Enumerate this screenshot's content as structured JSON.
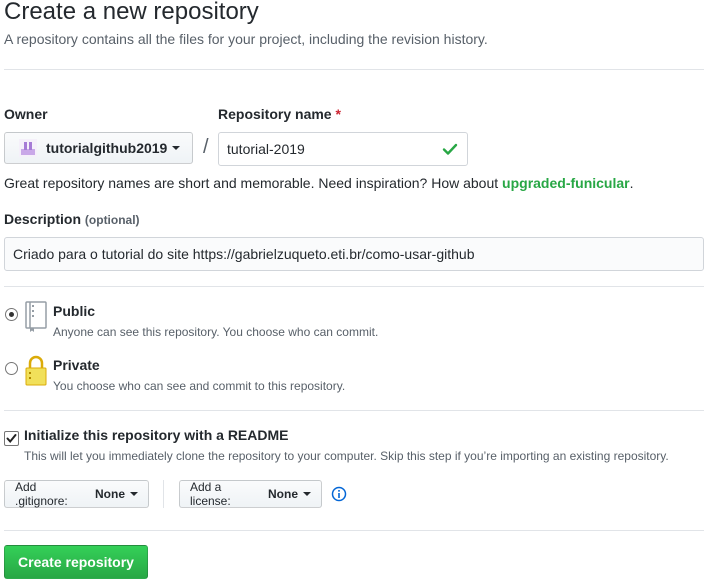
{
  "header": {
    "title": "Create a new repository",
    "subtitle": "A repository contains all the files for your project, including the revision history."
  },
  "owner": {
    "label": "Owner",
    "value": "tutorialgithub2019"
  },
  "separator": "/",
  "repo_name": {
    "label": "Repository name",
    "required_mark": "*",
    "value": "tutorial-2019"
  },
  "name_hint": {
    "prefix": "Great repository names are short and memorable. Need inspiration? How about ",
    "suggestion": "upgraded-funicular",
    "suffix": "."
  },
  "description": {
    "label": "Description",
    "optional": "(optional)",
    "value": "Criado para o tutorial do site https://gabrielzuqueto.eti.br/como-usar-github"
  },
  "visibility": {
    "selected": "public",
    "public": {
      "title": "Public",
      "note": "Anyone can see this repository. You choose who can commit.",
      "icon": "repo-book-icon"
    },
    "private": {
      "title": "Private",
      "note": "You choose who can see and commit to this repository.",
      "icon": "lock-icon"
    }
  },
  "readme": {
    "checked": true,
    "title": "Initialize this repository with a README",
    "note": "This will let you immediately clone the repository to your computer. Skip this step if you’re importing an existing repository."
  },
  "gitignore": {
    "label": "Add .gitignore:",
    "value": "None"
  },
  "license": {
    "label": "Add a license:",
    "value": "None"
  },
  "submit": {
    "label": "Create repository"
  },
  "colors": {
    "accent_green": "#28a745",
    "required_red": "#cb2431",
    "info_blue": "#0366d6"
  }
}
